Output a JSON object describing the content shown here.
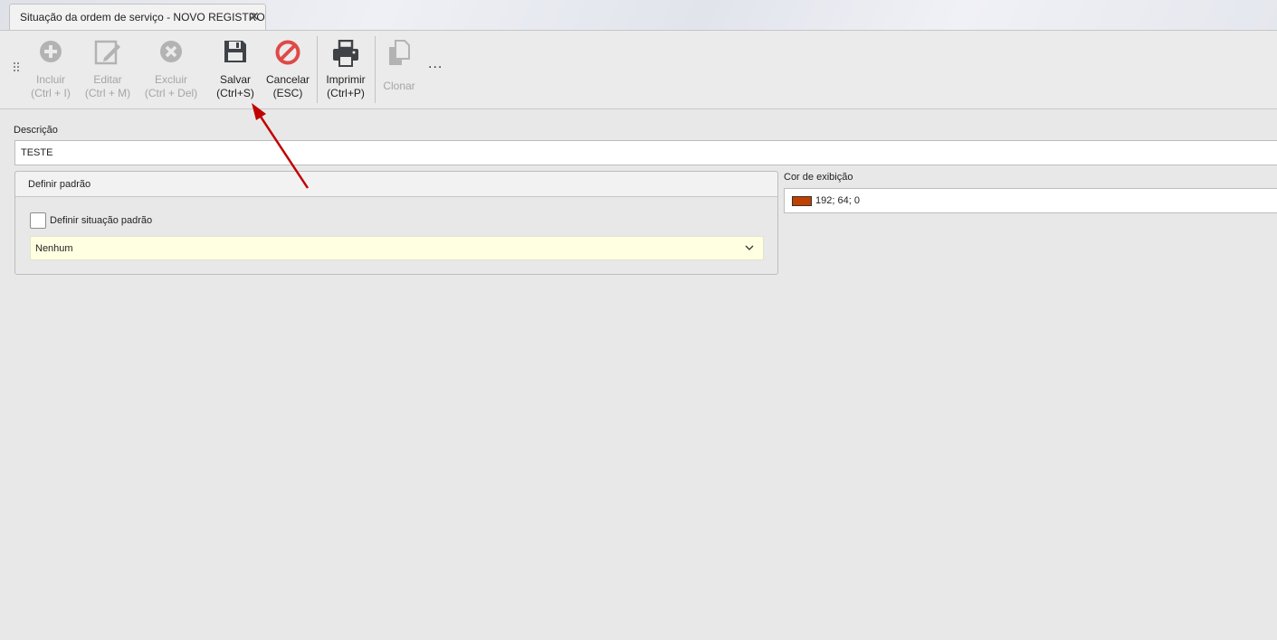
{
  "tab": {
    "title": "Situação da ordem de serviço - NOVO REGISTRO",
    "close_glyph": "✕"
  },
  "toolbar": {
    "buttons": [
      {
        "id": "incluir",
        "line1": "Incluir",
        "line2": "(Ctrl + I)",
        "icon": "plus-circle-icon",
        "enabled": false
      },
      {
        "id": "editar",
        "line1": "Editar",
        "line2": "(Ctrl + M)",
        "icon": "edit-icon",
        "enabled": false
      },
      {
        "id": "excluir",
        "line1": "Excluir",
        "line2": "(Ctrl + Del)",
        "icon": "x-circle-icon",
        "enabled": false
      },
      {
        "id": "salvar",
        "line1": "Salvar",
        "line2": "(Ctrl+S)",
        "icon": "floppy-disk-icon",
        "enabled": true
      },
      {
        "id": "cancelar",
        "line1": "Cancelar",
        "line2": "(ESC)",
        "icon": "no-entry-icon",
        "enabled": true
      },
      {
        "id": "imprimir",
        "line1": "Imprimir",
        "line2": "(Ctrl+P)",
        "icon": "printer-icon",
        "enabled": true
      },
      {
        "id": "clonar",
        "line1": "Clonar",
        "line2": "",
        "icon": "copy-icon",
        "enabled": false
      }
    ],
    "more": "..."
  },
  "form": {
    "descricao": {
      "label": "Descrição",
      "value": "TESTE"
    },
    "definir_padrao": {
      "title": "Definir padrão",
      "checkbox_label": "Definir situação padrão",
      "checked": false,
      "combo_value": "Nenhum"
    },
    "cor_exibicao": {
      "label": "Cor de exibição",
      "value": "192; 64; 0",
      "swatch_color": "#c04000"
    }
  },
  "colors": {
    "cancel_red": "#e04848",
    "annotation_arrow": "#c00000",
    "combo_bg": "#ffffe1"
  }
}
